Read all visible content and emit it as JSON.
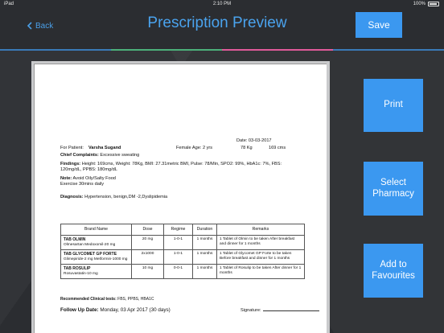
{
  "statusbar": {
    "carrier": "iPad",
    "time": "2:10 PM",
    "battery": "100%"
  },
  "header": {
    "back_label": "Back",
    "title": "Prescription Preview",
    "save_label": "Save"
  },
  "color_bar": [
    "#3a7ab8",
    "#4cb07a",
    "#e05a9a",
    "#3a7ab8"
  ],
  "actions": {
    "print": "Print",
    "select_pharmacy": "Select\nPharmacy",
    "add_favourites": "Add to\nFavourites"
  },
  "prescription": {
    "date": "Date: 03-03-2017",
    "patient_prefix": "For Patient:",
    "patient_name": "Varsha Sugand",
    "gender_age": "Female  Age: 2 yrs",
    "weight": "78 Kg",
    "height": "169 cms",
    "complaints_label": "Chief Complaints:",
    "complaints_value": "Excessive sweating",
    "findings_label": "Findings:",
    "findings_value": "Height: 169cms, Weight: 78Kg, BMI: 27.31metric BMI, Pulse: 78/Min, SPO2: 99%, HbA1c: 7%, FBS: 120mg/dL, PPBS: 180mg/dL",
    "note_label": "Note:",
    "note_value": "Avoid Oily/Salty Food",
    "note_line2": "Exercise 30mins daily",
    "diagnosis_label": "Diagnosis:",
    "diagnosis_value": "Hypertension, benign,DM -2,Dyslipidemia",
    "table_headers": [
      "Brand Name",
      "Dose",
      "Regime",
      "Duration",
      "Remarks"
    ],
    "medicines": [
      {
        "name": "TAB OLMIN",
        "generic": "Olmesartan Medoxomil-20 mg",
        "dose": "20 mg",
        "regime": "1-0-1",
        "duration": "1 months",
        "remarks": "1 Tablet of Olmin to be taken After breakfast and dinner for 1 months"
      },
      {
        "name": "TAB GLYCOMET GP FORTE",
        "generic": "Glimepiride-2 mg Metformin-1000 mg",
        "dose": "2x1000",
        "regime": "1-0-1",
        "duration": "1 months",
        "remarks": "1 Tablet of Glycomet GP Forte to be taken Before breakfast and dinner for 1 months"
      },
      {
        "name": "TAB ROSULIP",
        "generic": "Rosuvastatin-10 mg",
        "dose": "10 mg",
        "regime": "0-0-1",
        "duration": "1 months",
        "remarks": "1 Tablet of Rosulip to be taken After dinner for 1 months"
      }
    ],
    "tests_label": "Recommended Clinical tests:",
    "tests_value": "FBS, PPBS, HBA1C",
    "followup_label": "Follow Up Date:",
    "followup_value": "Monday, 03 Apr 2017 (30 days)",
    "signature_label": "Signature:"
  }
}
